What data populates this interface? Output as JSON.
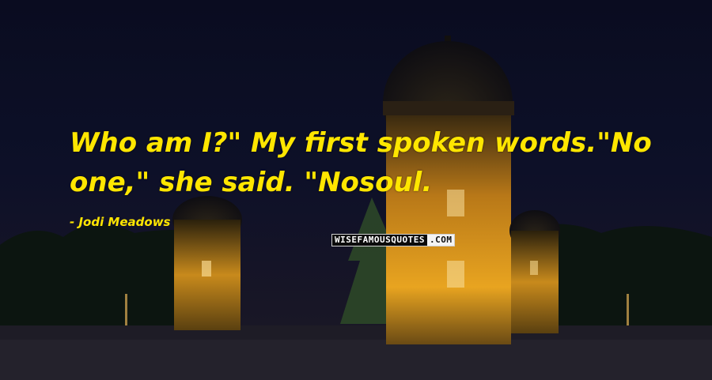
{
  "quote": {
    "text": "Who am I?\" My first spoken words.\"No one,\" she said. \"Nosoul.",
    "author": "- Jodi Meadows"
  },
  "watermark": {
    "part1": "WISEFAMOUSQUOTES",
    "part2": ".COM"
  },
  "colors": {
    "text": "#ffe600",
    "sky": "#0b0d1f",
    "tower_glow": "#e0a020"
  }
}
